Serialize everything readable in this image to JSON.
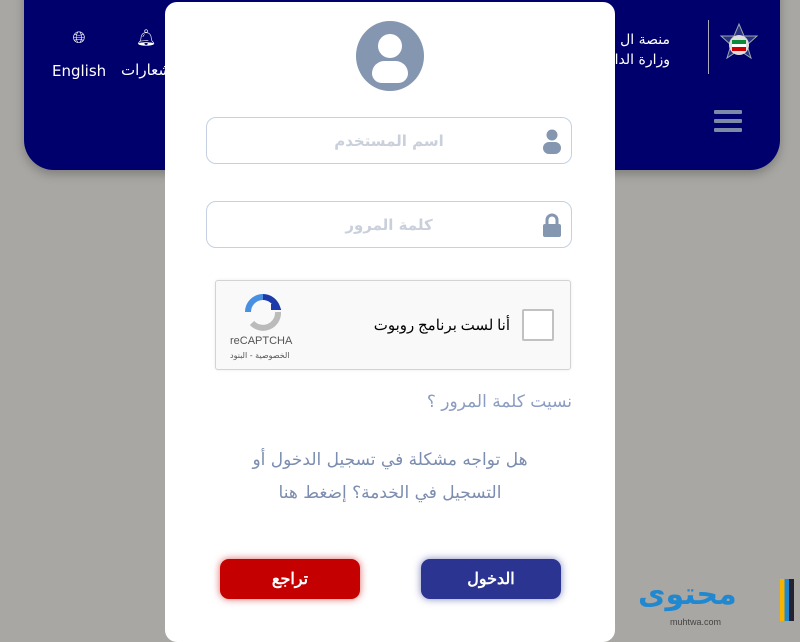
{
  "header": {
    "language_label": "English",
    "notifications_label": "شعارات",
    "brand_line1": "منصة ال",
    "brand_line2": "وزارة الدا",
    "icons": {
      "language": "globe-icon",
      "notifications": "bell-icon",
      "menu": "hamburger-icon"
    }
  },
  "login": {
    "username_placeholder": "اسم المستخدم",
    "password_placeholder": "كلمة المرور",
    "captcha": {
      "label": "أنا لست برنامج روبوت",
      "brand": "reCAPTCHA",
      "links": "الخصوصية - البنود",
      "checked": false
    },
    "forgot_password": "نسيت كلمة المرور ؟",
    "help_line1": "هل تواجه مشكلة في تسجيل الدخول أو",
    "help_line2": "التسجيل في الخدمة؟ إضغط هنا",
    "login_button": "الدخول",
    "back_button": "تراجع"
  },
  "watermark": {
    "text": "محتوى",
    "url": "muhtwa.com"
  },
  "colors": {
    "header": "#00006c",
    "login_button": "#2b3490",
    "back_button": "#c40000",
    "accent_text": "#8c9dc2"
  }
}
